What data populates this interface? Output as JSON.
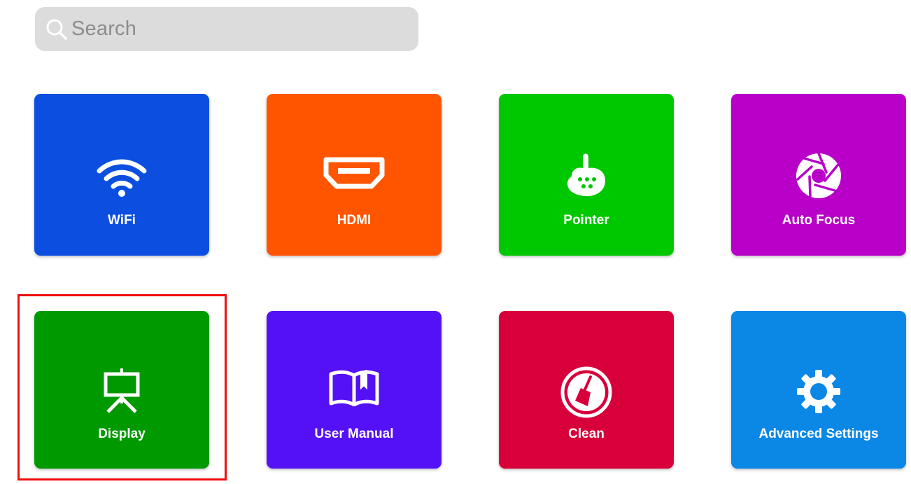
{
  "search": {
    "placeholder": "Search",
    "icon": "search-icon"
  },
  "tiles": [
    {
      "label": "WiFi",
      "color": "#0c4fe0",
      "icon": "wifi-icon"
    },
    {
      "label": "HDMI",
      "color": "#ff5500",
      "icon": "hdmi-icon"
    },
    {
      "label": "Pointer",
      "color": "#00c800",
      "icon": "pointer-remote-icon"
    },
    {
      "label": "Auto Focus",
      "color": "#b800c8",
      "icon": "aperture-icon"
    },
    {
      "label": "Display",
      "color": "#009900",
      "icon": "easel-screen-icon"
    },
    {
      "label": "User Manual",
      "color": "#5511f6",
      "icon": "open-book-icon"
    },
    {
      "label": "Clean",
      "color": "#d8003a",
      "icon": "broom-icon"
    },
    {
      "label": "Advanced Settings",
      "color": "#0b87e6",
      "icon": "gear-icon"
    }
  ],
  "highlight": {
    "color": "#f00d0d",
    "target": "Display"
  }
}
